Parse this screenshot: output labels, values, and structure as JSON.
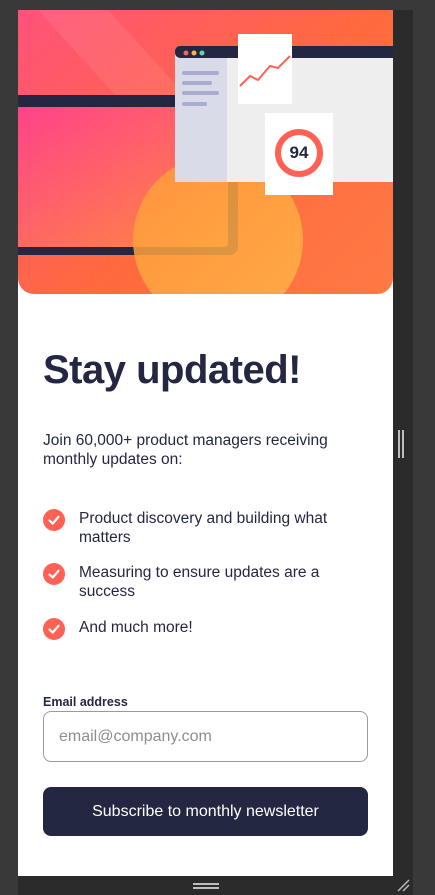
{
  "hero": {
    "score_value": "94",
    "colors": {
      "primary_gradient_start": "#ff527b",
      "primary_gradient_end": "#ff6a3d",
      "dark_navy": "#242742"
    }
  },
  "content": {
    "title": "Stay updated!",
    "intro": "Join 60,000+ product managers receiving monthly updates on:",
    "list": [
      {
        "icon": "check-icon",
        "text": "Product discovery and building what matters"
      },
      {
        "icon": "check-icon",
        "text": "Measuring to ensure updates are a success"
      },
      {
        "icon": "check-icon",
        "text": "And much more!"
      }
    ]
  },
  "form": {
    "email_label": "Email address",
    "email_placeholder": "email@company.com",
    "email_value": "",
    "subscribe_label": "Subscribe to monthly newsletter"
  },
  "colors": {
    "accent": "#ff6155",
    "text": "#242742",
    "background_outer": "#393939",
    "button": "#242742"
  }
}
